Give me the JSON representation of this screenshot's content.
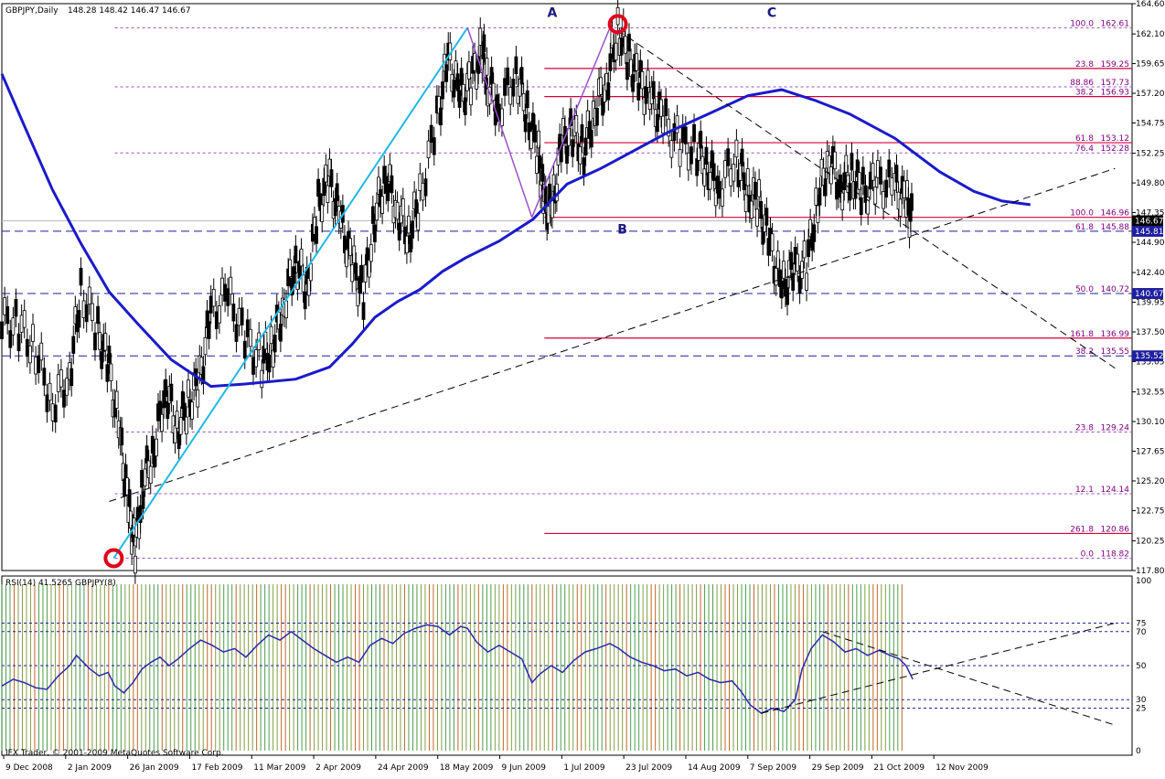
{
  "chart_data": [
    {
      "type": "candlestick",
      "symbol_label": "GBPJPY,Daily",
      "ohlc_label": "148.28 148.42 146.47 146.67",
      "ylim": [
        117.8,
        164.6
      ],
      "y_ticks": [
        "164.60",
        "162.10",
        "159.65",
        "157.20",
        "154.75",
        "152.25",
        "149.80",
        "147.35",
        "144.90",
        "142.40",
        "139.95",
        "137.50",
        "135.05",
        "132.55",
        "130.10",
        "127.65",
        "125.20",
        "122.75",
        "120.25",
        "117.80"
      ],
      "price_tags": [
        {
          "value": "146.67",
          "color": "#000000"
        },
        {
          "value": "145.81",
          "color": "#1f1f9f"
        },
        {
          "value": "140.67",
          "color": "#1f1f9f"
        },
        {
          "value": "135.52",
          "color": "#1f1f9f"
        }
      ],
      "blue_dashed_levels": [
        145.81,
        140.67,
        135.52
      ],
      "fib_lines": [
        {
          "ratio": "100.0",
          "value": "162.61",
          "y": 162.61,
          "x_from": 0.1,
          "style": "dotted"
        },
        {
          "ratio": "88.86",
          "value": "157.73",
          "y": 157.73,
          "x_from": 0.1,
          "style": "dotted"
        },
        {
          "ratio": "76.4",
          "value": "152.28",
          "y": 152.28,
          "x_from": 0.1,
          "style": "dotted"
        },
        {
          "ratio": "23.8",
          "value": "129.24",
          "y": 129.24,
          "x_from": 0.1,
          "style": "dotted"
        },
        {
          "ratio": "12.1",
          "value": "124.14",
          "y": 124.14,
          "x_from": 0.1,
          "style": "dotted"
        },
        {
          "ratio": "0.0",
          "value": "118.82",
          "y": 118.82,
          "x_from": 0.1,
          "style": "dotted"
        },
        {
          "ratio": "23.8",
          "value": "159.25",
          "y": 159.25,
          "x_from": 0.48,
          "style": "red"
        },
        {
          "ratio": "38.2",
          "value": "156.93",
          "y": 156.93,
          "x_from": 0.48,
          "style": "red"
        },
        {
          "ratio": "61.8",
          "value": "153.12",
          "y": 153.12,
          "x_from": 0.48,
          "style": "red"
        },
        {
          "ratio": "100.0",
          "value": "146.96",
          "y": 146.96,
          "x_from": 0.48,
          "style": "red"
        },
        {
          "ratio": "161.8",
          "value": "136.99",
          "y": 136.99,
          "x_from": 0.48,
          "style": "red"
        },
        {
          "ratio": "261.8",
          "value": "120.86",
          "y": 120.86,
          "x_from": 0.48,
          "style": "red"
        },
        {
          "ratio": "61.8",
          "value": "145.88",
          "y": 145.81,
          "x_from": -1,
          "style": "label"
        },
        {
          "ratio": "50.0",
          "value": "140.72",
          "y": 140.67,
          "x_from": -1,
          "style": "label"
        },
        {
          "ratio": "38.2",
          "value": "135.55",
          "y": 135.52,
          "x_from": -1,
          "style": "label"
        }
      ],
      "points": [
        {
          "label": "A",
          "x": 0.487,
          "y": 162.61
        },
        {
          "label": "B",
          "x": 0.549,
          "y": 146.96
        },
        {
          "label": "C",
          "x": 0.657,
          "y": 162.61
        }
      ],
      "ma_curve": [
        [
          0.0,
          158.8
        ],
        [
          0.02,
          154.5
        ],
        [
          0.045,
          149.2
        ],
        [
          0.07,
          144.8
        ],
        [
          0.095,
          140.8
        ],
        [
          0.12,
          138.2
        ],
        [
          0.15,
          135.2
        ],
        [
          0.185,
          133.0
        ],
        [
          0.215,
          133.2
        ],
        [
          0.26,
          133.6
        ],
        [
          0.29,
          134.6
        ],
        [
          0.31,
          136.5
        ],
        [
          0.33,
          138.7
        ],
        [
          0.35,
          140.0
        ],
        [
          0.37,
          141.0
        ],
        [
          0.39,
          142.5
        ],
        [
          0.41,
          143.6
        ],
        [
          0.44,
          145.0
        ],
        [
          0.47,
          146.8
        ],
        [
          0.5,
          149.7
        ],
        [
          0.53,
          151.0
        ],
        [
          0.56,
          152.5
        ],
        [
          0.59,
          154.0
        ],
        [
          0.63,
          155.7
        ],
        [
          0.66,
          157.0
        ],
        [
          0.69,
          157.5
        ],
        [
          0.72,
          156.6
        ],
        [
          0.75,
          155.5
        ],
        [
          0.79,
          153.5
        ],
        [
          0.83,
          150.7
        ],
        [
          0.86,
          149.1
        ],
        [
          0.885,
          148.3
        ],
        [
          0.91,
          148.0
        ]
      ],
      "ema_curve": [
        [
          0.0,
          158.4
        ],
        [
          0.003,
          157.5
        ]
      ],
      "candle_path": [
        [
          0.0,
          138.5
        ],
        [
          0.015,
          138.0
        ],
        [
          0.03,
          136.0
        ],
        [
          0.045,
          131.5
        ],
        [
          0.06,
          134.0
        ],
        [
          0.07,
          141.0
        ],
        [
          0.085,
          137.5
        ],
        [
          0.095,
          134.5
        ],
        [
          0.105,
          128.5
        ],
        [
          0.112,
          123.0
        ],
        [
          0.118,
          119.5
        ],
        [
          0.125,
          125.0
        ],
        [
          0.135,
          128.0
        ],
        [
          0.145,
          133.0
        ],
        [
          0.155,
          129.5
        ],
        [
          0.165,
          131.5
        ],
        [
          0.175,
          133.5
        ],
        [
          0.185,
          139.0
        ],
        [
          0.2,
          140.5
        ],
        [
          0.215,
          137.0
        ],
        [
          0.23,
          135.0
        ],
        [
          0.24,
          136.5
        ],
        [
          0.25,
          140.0
        ],
        [
          0.26,
          143.5
        ],
        [
          0.27,
          141.0
        ],
        [
          0.28,
          148.0
        ],
        [
          0.29,
          150.0
        ],
        [
          0.3,
          146.5
        ],
        [
          0.31,
          143.0
        ],
        [
          0.32,
          140.5
        ],
        [
          0.33,
          147.0
        ],
        [
          0.34,
          150.5
        ],
        [
          0.35,
          147.5
        ],
        [
          0.36,
          145.5
        ],
        [
          0.37,
          148.5
        ],
        [
          0.385,
          155.0
        ],
        [
          0.395,
          160.0
        ],
        [
          0.405,
          157.0
        ],
        [
          0.415,
          158.0
        ],
        [
          0.425,
          161.0
        ],
        [
          0.43,
          158.0
        ],
        [
          0.44,
          156.0
        ],
        [
          0.455,
          159.0
        ],
        [
          0.465,
          155.5
        ],
        [
          0.475,
          152.0
        ],
        [
          0.48,
          148.0
        ],
        [
          0.487,
          147.5
        ],
        [
          0.495,
          153.0
        ],
        [
          0.505,
          154.0
        ],
        [
          0.515,
          152.5
        ],
        [
          0.525,
          156.0
        ],
        [
          0.535,
          158.0
        ],
        [
          0.545,
          162.6
        ],
        [
          0.555,
          160.0
        ],
        [
          0.565,
          158.0
        ],
        [
          0.575,
          156.5
        ],
        [
          0.585,
          155.0
        ],
        [
          0.6,
          153.0
        ],
        [
          0.615,
          152.5
        ],
        [
          0.625,
          151.0
        ],
        [
          0.635,
          149.5
        ],
        [
          0.65,
          152.0
        ],
        [
          0.66,
          149.0
        ],
        [
          0.67,
          148.0
        ],
        [
          0.68,
          144.5
        ],
        [
          0.69,
          141.0
        ],
        [
          0.7,
          142.5
        ],
        [
          0.712,
          143.0
        ],
        [
          0.722,
          148.5
        ],
        [
          0.732,
          152.0
        ],
        [
          0.742,
          149.5
        ],
        [
          0.752,
          150.5
        ],
        [
          0.762,
          149.0
        ],
        [
          0.775,
          149.8
        ],
        [
          0.79,
          149.5
        ],
        [
          0.8,
          148.2
        ],
        [
          0.806,
          146.6
        ]
      ],
      "trendlines": [
        {
          "style": "cyan",
          "from": [
            0.099,
            118.82
          ],
          "to": [
            0.412,
            162.61
          ]
        },
        {
          "style": "purple",
          "from": [
            0.412,
            162.61
          ],
          "to": [
            0.469,
            146.96
          ]
        },
        {
          "style": "purple",
          "from": [
            0.469,
            146.96
          ],
          "to": [
            0.538,
            162.61
          ]
        },
        {
          "style": "dashed",
          "from": [
            0.095,
            123.5
          ],
          "to": [
            0.985,
            151.0
          ]
        },
        {
          "style": "dashed",
          "from": [
            0.545,
            162.4
          ],
          "to": [
            0.985,
            134.5
          ]
        }
      ]
    },
    {
      "type": "line",
      "label": "RSI(14) 41.5265 GBPJPY(8)",
      "ylim": [
        0,
        100
      ],
      "y_ticks": [
        "100",
        "75",
        "70",
        "50",
        "30",
        "25",
        "0"
      ],
      "levels": [
        75,
        70,
        50,
        30,
        25
      ],
      "series": [
        [
          0.0,
          38
        ],
        [
          0.01,
          42
        ],
        [
          0.02,
          40
        ],
        [
          0.03,
          37
        ],
        [
          0.04,
          36
        ],
        [
          0.05,
          44
        ],
        [
          0.06,
          50
        ],
        [
          0.066,
          56
        ],
        [
          0.072,
          52
        ],
        [
          0.078,
          48
        ],
        [
          0.086,
          44
        ],
        [
          0.094,
          46
        ],
        [
          0.1,
          38
        ],
        [
          0.108,
          34
        ],
        [
          0.116,
          40
        ],
        [
          0.124,
          48
        ],
        [
          0.132,
          52
        ],
        [
          0.14,
          55
        ],
        [
          0.148,
          50
        ],
        [
          0.156,
          54
        ],
        [
          0.166,
          60
        ],
        [
          0.176,
          65
        ],
        [
          0.186,
          62
        ],
        [
          0.196,
          58
        ],
        [
          0.206,
          60
        ],
        [
          0.216,
          55
        ],
        [
          0.226,
          62
        ],
        [
          0.236,
          68
        ],
        [
          0.246,
          65
        ],
        [
          0.256,
          70
        ],
        [
          0.266,
          65
        ],
        [
          0.276,
          60
        ],
        [
          0.286,
          56
        ],
        [
          0.296,
          52
        ],
        [
          0.306,
          55
        ],
        [
          0.316,
          52
        ],
        [
          0.326,
          62
        ],
        [
          0.336,
          66
        ],
        [
          0.346,
          63
        ],
        [
          0.356,
          69
        ],
        [
          0.366,
          72
        ],
        [
          0.376,
          74
        ],
        [
          0.386,
          73
        ],
        [
          0.396,
          68
        ],
        [
          0.406,
          73
        ],
        [
          0.412,
          72
        ],
        [
          0.42,
          64
        ],
        [
          0.43,
          58
        ],
        [
          0.44,
          62
        ],
        [
          0.45,
          58
        ],
        [
          0.46,
          54
        ],
        [
          0.469,
          40
        ],
        [
          0.476,
          45
        ],
        [
          0.486,
          50
        ],
        [
          0.496,
          46
        ],
        [
          0.506,
          53
        ],
        [
          0.516,
          58
        ],
        [
          0.526,
          60
        ],
        [
          0.538,
          63
        ],
        [
          0.546,
          60
        ],
        [
          0.556,
          55
        ],
        [
          0.566,
          52
        ],
        [
          0.576,
          50
        ],
        [
          0.586,
          47
        ],
        [
          0.596,
          48
        ],
        [
          0.606,
          44
        ],
        [
          0.616,
          46
        ],
        [
          0.626,
          42
        ],
        [
          0.636,
          40
        ],
        [
          0.646,
          41
        ],
        [
          0.654,
          35
        ],
        [
          0.662,
          27
        ],
        [
          0.672,
          22
        ],
        [
          0.682,
          25
        ],
        [
          0.692,
          23
        ],
        [
          0.702,
          30
        ],
        [
          0.708,
          48
        ],
        [
          0.716,
          60
        ],
        [
          0.726,
          68
        ],
        [
          0.736,
          64
        ],
        [
          0.746,
          58
        ],
        [
          0.756,
          60
        ],
        [
          0.766,
          56
        ],
        [
          0.776,
          59
        ],
        [
          0.786,
          56
        ],
        [
          0.794,
          54
        ],
        [
          0.8,
          50
        ],
        [
          0.806,
          42
        ]
      ],
      "trendlines": [
        {
          "style": "dashed",
          "from": [
            0.672,
            22
          ],
          "to": [
            0.985,
            75
          ]
        },
        {
          "style": "dashed",
          "from": [
            0.726,
            70
          ],
          "to": [
            0.985,
            15
          ]
        }
      ]
    }
  ],
  "x_axis_labels": [
    "9 Dec 2008",
    "2 Jan 2009",
    "26 Jan 2009",
    "17 Feb 2009",
    "11 Mar 2009",
    "2 Apr 2009",
    "24 Apr 2009",
    "18 May 2009",
    "9 Jun 2009",
    "1 Jul 2009",
    "23 Jul 2009",
    "14 Aug 2009",
    "7 Sep 2009",
    "29 Sep 2009",
    "21 Oct 2009",
    "12 Nov 2009"
  ],
  "copyright": "IFX Trader, © 2001-2009 MetaQuotes Software Corp.",
  "colors": {
    "ma": "#1a1acc",
    "fib_dotted": "#9b4fc9",
    "fib_red": "#d4003a",
    "blue_dash": "#1f1f9f",
    "cyan": "#22b8e6",
    "purple": "#9a4fcf",
    "rsi_line": "#2a2aaa",
    "circle": "#e0001b"
  }
}
